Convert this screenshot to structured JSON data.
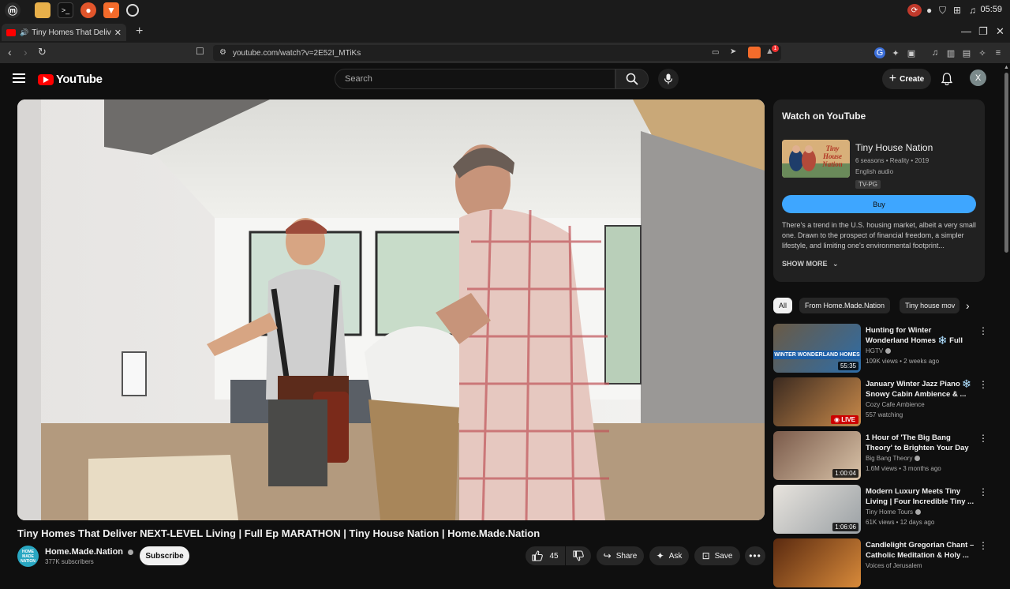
{
  "os": {
    "clock": "05:59"
  },
  "browser": {
    "tab_title": "Tiny Homes That Deliver N",
    "url": "youtube.com/watch?v=2E52I_MTiKs",
    "extension_badge": "1"
  },
  "youtube": {
    "logo_text": "YouTube",
    "search_placeholder": "Search",
    "create_label": "Create",
    "avatar_letter": "X"
  },
  "video": {
    "title": "Tiny Homes That Deliver NEXT-LEVEL Living | Full Ep MARATHON | Tiny House Nation | Home.Made.Nation",
    "channel_name": "Home.Made.Nation",
    "channel_avatar_text": "HOME MADE NATION",
    "subscribers": "377K subscribers",
    "subscribe_label": "Subscribe",
    "likes": "45",
    "share_label": "Share",
    "ask_label": "Ask",
    "save_label": "Save"
  },
  "watch_card": {
    "heading": "Watch on YouTube",
    "poster_text": "Tiny House Nation",
    "show_title": "Tiny House Nation",
    "meta_line": "6 seasons • Reality • 2019",
    "audio": "English audio",
    "rating": "TV-PG",
    "buy_label": "Buy",
    "description": "There's a trend in the U.S. housing market, albeit a very small one. Drawn to the prospect of financial freedom, a simpler lifestyle, and limiting one's environmental footprint...",
    "show_more": "SHOW MORE"
  },
  "chips": [
    "All",
    "From Home.Made.Nation",
    "Tiny house mov"
  ],
  "recommendations": [
    {
      "title": "Hunting for Winter Wonderland Homes ❄️ Full Episode ...",
      "channel": "HGTV",
      "verified": true,
      "meta": "109K views • 2 weeks ago",
      "badge": "55:35",
      "badge_type": "duration",
      "thumb_text": "WINTER WONDERLAND HOMES",
      "colors": [
        "#6a5a45",
        "#2d6da8"
      ]
    },
    {
      "title": "January Winter Jazz Piano ❄️ Snowy Cabin Ambience & ...",
      "channel": "Cozy Cafe Ambience",
      "verified": false,
      "meta": "557 watching",
      "badge": "LIVE",
      "badge_type": "live",
      "thumb_text": "",
      "colors": [
        "#3b2a20",
        "#c98a4a"
      ]
    },
    {
      "title": "1 Hour of 'The Big Bang Theory' to Brighten Your Day",
      "channel": "Big Bang Theory",
      "verified": true,
      "meta": "1.6M views • 3 months ago",
      "badge": "1:00:04",
      "badge_type": "duration",
      "thumb_text": "",
      "colors": [
        "#7a5a4a",
        "#d9c3a8"
      ]
    },
    {
      "title": "Modern Luxury Meets Tiny Living | Four Incredible Tiny ...",
      "channel": "Tiny Home Tours",
      "verified": true,
      "meta": "61K views • 12 days ago",
      "badge": "1:06:06",
      "badge_type": "duration",
      "thumb_text": "",
      "colors": [
        "#e8e4de",
        "#9aa0a4"
      ]
    },
    {
      "title": "Candlelight Gregorian Chant – Catholic Meditation & Holy ...",
      "channel": "Voices of Jerusalem",
      "verified": false,
      "meta": "",
      "badge": "",
      "badge_type": "none",
      "thumb_text": "",
      "colors": [
        "#5a2a10",
        "#d88a3a"
      ]
    }
  ],
  "colors": {
    "youtube_red": "#ff0000",
    "buy_blue": "#3ea6ff",
    "background": "#0f0f0f"
  }
}
